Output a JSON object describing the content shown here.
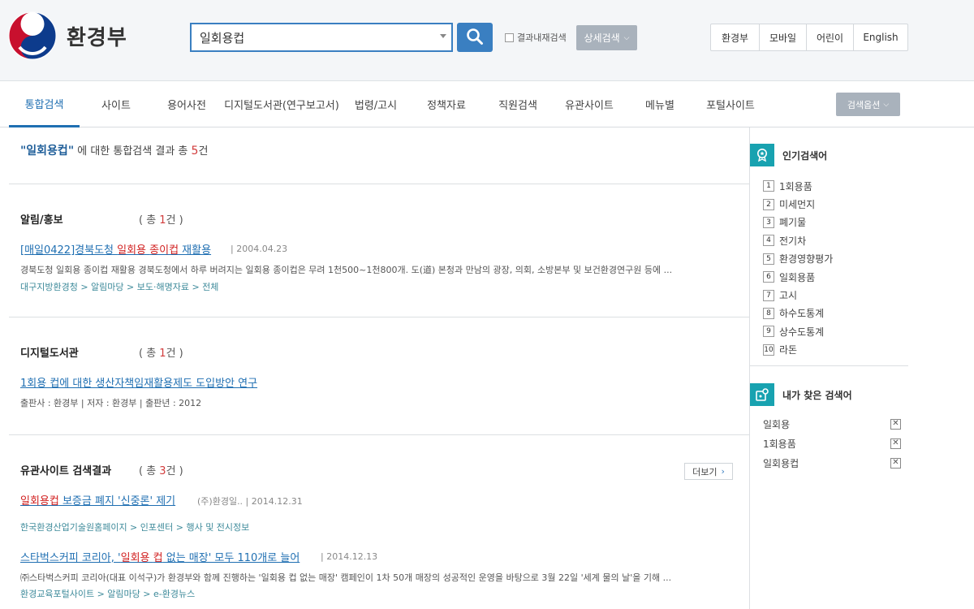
{
  "header": {
    "logo_text": "환경부",
    "search": {
      "value": "일회용컵"
    },
    "result_in_label": "결과내재검색",
    "detail_search_label": "상세검색",
    "top_links": [
      "환경부",
      "모바일",
      "어린이",
      "English"
    ]
  },
  "tabs": {
    "items": [
      "통합검색",
      "사이트",
      "용어사전",
      "디지털도서관(연구보고서)",
      "법령/고시",
      "정책자료",
      "직원검색",
      "유관사이트",
      "메뉴별",
      "포털사이트"
    ],
    "active": "통합검색",
    "options_label": "검색옵션"
  },
  "summary": {
    "query": "\"일회용컵\"",
    "text": " 에 대한 통합검색 결과 총 ",
    "count": "5",
    "unit": "건"
  },
  "sections": {
    "notice": {
      "title": "알림/홍보",
      "count_prefix": "( 총 ",
      "count": "1",
      "count_suffix": "건 )",
      "result": {
        "title_a": "[매일0422]경북도청 ",
        "title_hl1": "일회용",
        "title_b": " ",
        "title_hl2": "종이컵",
        "title_c": " 재활용",
        "date": "| 2004.04.23",
        "desc": "경북도청 일회용 종이컵 재활용 경북도청에서 하루 버려지는 일회용 종이컵은 무려 1천500~1천800개. 도(道) 본청과 만남의 광장, 의회, 소방본부 및 보건환경연구원 등에 ...",
        "path": "대구지방환경청 > 알림마당 > 보도·해명자료 > 전체"
      }
    },
    "library": {
      "title": "디지털도서관",
      "count_prefix": "( 총 ",
      "count": "1",
      "count_suffix": "건 )",
      "result": {
        "title": "1회용 컵에 대한 생산자책임재활용제도 도입방안 연구",
        "info": "출판사 : 환경부 | 저자 : 환경부 | 출판년 : 2012"
      }
    },
    "related": {
      "title": "유관사이트 검색결과",
      "count_prefix": "( 총 ",
      "count": "3",
      "count_suffix": "건 )",
      "more_label": "더보기",
      "results": [
        {
          "title_hl": "일회용컵",
          "title_rest": " 보증금 폐지 '신중론' 제기",
          "meta": "(주)환경일.. | 2014.12.31",
          "path": "한국환경산업기술원홈페이지 > 인포센터 > 행사 및 전시정보"
        },
        {
          "title_a": "스타벅스커피 코리아, '",
          "title_hl1": "일회용",
          "title_b": " ",
          "title_hl2": "컵",
          "title_c": " 없는 매장' 모두 110개로 늘어",
          "meta": "| 2014.12.13",
          "desc": "㈜스타벅스커피 코리아(대표 이석구)가 환경부와 함께 진행하는 '일회용 컵 없는 매장' 캠페인이 1차 50개 매장의 성공적인 운영을 바탕으로 3월 22일 '세계 물의 날'을 기해 ...",
          "path": "환경교육포털사이트 > 알림마당 > e-환경뉴스"
        }
      ]
    }
  },
  "sidebar": {
    "popular_title": "인기검색어",
    "popular": [
      {
        "rank": "1",
        "term": "1회용품"
      },
      {
        "rank": "2",
        "term": "미세먼지"
      },
      {
        "rank": "3",
        "term": "폐기물"
      },
      {
        "rank": "4",
        "term": "전기차"
      },
      {
        "rank": "5",
        "term": "환경영향평가"
      },
      {
        "rank": "6",
        "term": "일회용품"
      },
      {
        "rank": "7",
        "term": "고시"
      },
      {
        "rank": "8",
        "term": "하수도통계"
      },
      {
        "rank": "9",
        "term": "상수도통계"
      },
      {
        "rank": "10",
        "term": "라돈"
      }
    ],
    "my_title": "내가 찾은 검색어",
    "my_searches": [
      "일회용",
      "1회용품",
      "일회용컵"
    ]
  },
  "colors": {
    "accent": "#1f6fb2",
    "highlight": "#d11f1f",
    "teal": "#18a2b0",
    "button_gray": "#a9b2bc"
  }
}
